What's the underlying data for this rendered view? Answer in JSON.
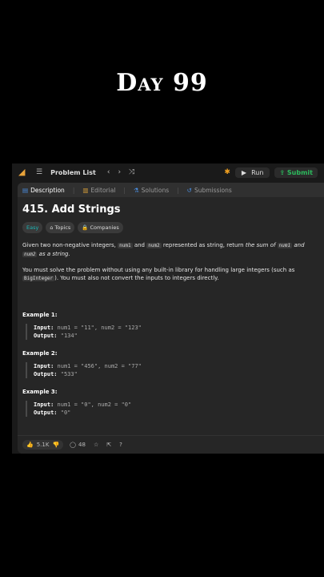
{
  "overlay": {
    "title": "Day 99"
  },
  "topbar": {
    "problem_list": "Problem List",
    "run": "Run",
    "submit": "Submit"
  },
  "tabs": [
    {
      "label": "Description"
    },
    {
      "label": "Editorial"
    },
    {
      "label": "Solutions"
    },
    {
      "label": "Submissions"
    }
  ],
  "problem": {
    "title": "415. Add Strings",
    "difficulty": "Easy",
    "topics": "Topics",
    "companies": "Companies",
    "p1_a": "Given two non-negative integers, ",
    "p1_num1": "num1",
    "p1_b": " and ",
    "p1_num2": "num2",
    "p1_c": " represented as string, return ",
    "p1_d": "the sum of ",
    "p1_num1b": "num1",
    "p1_e": " and ",
    "p1_num2b": "num2",
    "p1_f": " as a string.",
    "p2_a": "You must solve the problem without using any built-in library for handling large integers (such as ",
    "p2_code": "BigInteger",
    "p2_b": "). You must also not convert the inputs to integers directly."
  },
  "examples": [
    {
      "heading": "Example 1:",
      "input_label": "Input:",
      "input": "num1 = \"11\", num2 = \"123\"",
      "output_label": "Output:",
      "output": "\"134\""
    },
    {
      "heading": "Example 2:",
      "input_label": "Input:",
      "input": "num1 = \"456\", num2 = \"77\"",
      "output_label": "Output:",
      "output": "\"533\""
    },
    {
      "heading": "Example 3:",
      "input_label": "Input:",
      "input": "num1 = \"0\", num2 = \"0\"",
      "output_label": "Output:",
      "output": "\"0\""
    }
  ],
  "bottom": {
    "likes": "5.1K",
    "comments": "48"
  },
  "colors": {
    "easy": "#1cb8b8",
    "submit": "#2cbb5d",
    "accent": "#e8a33a"
  }
}
